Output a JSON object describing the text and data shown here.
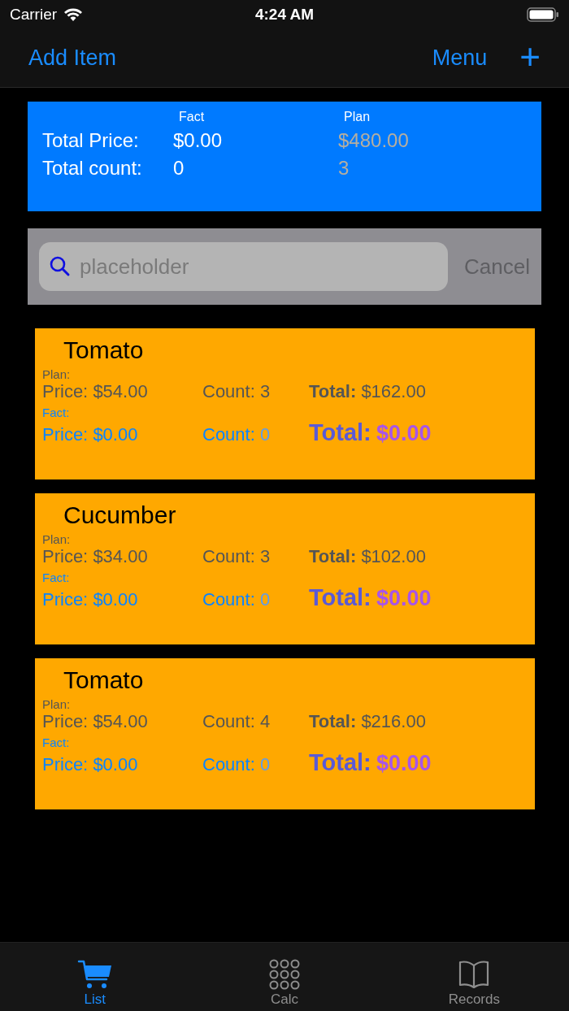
{
  "status_bar": {
    "carrier": "Carrier",
    "time": "4:24 AM"
  },
  "nav_bar": {
    "left": "Add Item",
    "right": "Menu",
    "add": "+"
  },
  "summary": {
    "headers": [
      "Fact",
      "Plan"
    ],
    "rows": [
      {
        "label": "Total Price:",
        "fact": "$0.00",
        "plan": "$480.00"
      },
      {
        "label": "Total count:",
        "fact": "0",
        "plan": "3"
      }
    ]
  },
  "search": {
    "placeholder": "placeholder",
    "cancel": "Cancel"
  },
  "items": [
    {
      "name": "Tomato",
      "sections": [
        {
          "kind": "plan",
          "heading": "Plan:",
          "price_label": "Price:",
          "price": "$54.00",
          "count_label": "Count:",
          "count": "3",
          "total_label": "Total:",
          "total": "$162.00"
        },
        {
          "kind": "fact",
          "heading": "Fact:",
          "price_label": "Price:",
          "price": "$0.00",
          "count_label": "Count:",
          "count": "0",
          "total_label": "Total:",
          "total": "$0.00"
        }
      ]
    },
    {
      "name": "Cucumber",
      "sections": [
        {
          "kind": "plan",
          "heading": "Plan:",
          "price_label": "Price:",
          "price": "$34.00",
          "count_label": "Count:",
          "count": "3",
          "total_label": "Total:",
          "total": "$102.00"
        },
        {
          "kind": "fact",
          "heading": "Fact:",
          "price_label": "Price:",
          "price": "$0.00",
          "count_label": "Count:",
          "count": "0",
          "total_label": "Total:",
          "total": "$0.00"
        }
      ]
    },
    {
      "name": "Tomato",
      "sections": [
        {
          "kind": "plan",
          "heading": "Plan:",
          "price_label": "Price:",
          "price": "$54.00",
          "count_label": "Count:",
          "count": "4",
          "total_label": "Total:",
          "total": "$216.00"
        },
        {
          "kind": "fact",
          "heading": "Fact:",
          "price_label": "Price:",
          "price": "$0.00",
          "count_label": "Count:",
          "count": "0",
          "total_label": "Total:",
          "total": "$0.00"
        }
      ]
    }
  ],
  "tabs": [
    {
      "label": "List",
      "kind": "cart",
      "selected": true
    },
    {
      "label": "Calc",
      "kind": "keypad",
      "selected": false
    },
    {
      "label": "Records",
      "kind": "book",
      "selected": false
    }
  ]
}
